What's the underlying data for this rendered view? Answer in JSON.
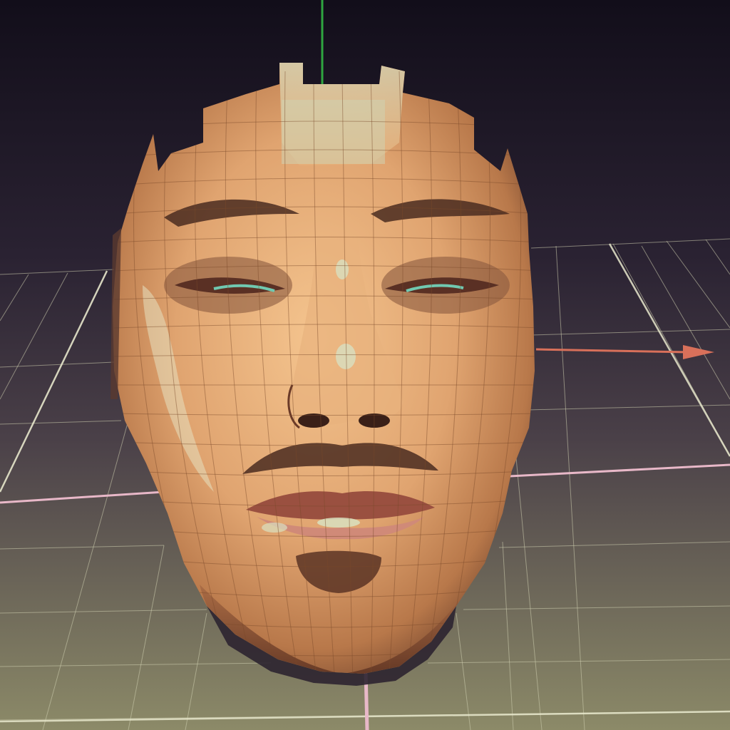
{
  "viewport": {
    "colors": {
      "background_top": "#14101c",
      "background_mid": "#3a3040",
      "floor_near": "#8a8a68",
      "grid_line": "#d8d8b8",
      "axis_x": "#d8705a",
      "axis_y": "#2fa640",
      "axis_z": "#e8b8c8",
      "skin_light": "#f0c08a",
      "skin_mid": "#d89868",
      "skin_dark": "#9a5a3a",
      "wire": "#7a4a2a",
      "highlight": "#d8e0c0",
      "eye_tint": "#70c8b0"
    },
    "objects": {
      "mesh_name": "face-scan-mesh",
      "axes": [
        "x-axis",
        "y-axis",
        "z-axis"
      ],
      "grid": "ground-grid"
    }
  }
}
